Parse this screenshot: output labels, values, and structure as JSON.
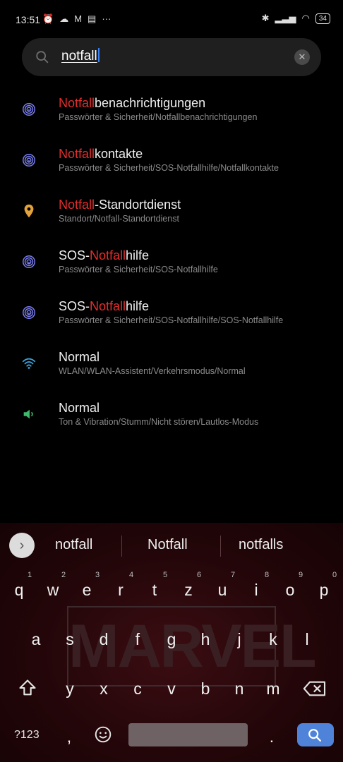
{
  "status": {
    "time": "13:51",
    "battery": "34"
  },
  "search": {
    "query": "notfall"
  },
  "results": [
    {
      "icon": "fingerprint-icon",
      "title_highlight": "Notfall",
      "title_pre": "",
      "title_post": "benachrichtigungen",
      "subtitle": "Passwörter & Sicherheit/Notfallbenachrichtigungen"
    },
    {
      "icon": "fingerprint-icon",
      "title_highlight": "Notfall",
      "title_pre": "",
      "title_post": "kontakte",
      "subtitle": "Passwörter & Sicherheit/SOS-Notfallhilfe/Notfallkontakte"
    },
    {
      "icon": "location-pin-icon",
      "title_highlight": "Notfall",
      "title_pre": "",
      "title_post": "-Standortdienst",
      "subtitle": "Standort/Notfall-Standortdienst"
    },
    {
      "icon": "fingerprint-icon",
      "title_highlight": "Notfall",
      "title_pre": "SOS-",
      "title_post": "hilfe",
      "subtitle": "Passwörter & Sicherheit/SOS-Notfallhilfe"
    },
    {
      "icon": "fingerprint-icon",
      "title_highlight": "Notfall",
      "title_pre": "SOS-",
      "title_post": "hilfe",
      "subtitle": "Passwörter & Sicherheit/SOS-Notfallhilfe/SOS-Notfallhilfe"
    },
    {
      "icon": "wifi-icon",
      "title_highlight": "",
      "title_pre": "Normal",
      "title_post": "",
      "subtitle": "WLAN/WLAN-Assistent/Verkehrsmodus/Normal"
    },
    {
      "icon": "speaker-icon",
      "title_highlight": "",
      "title_pre": "Normal",
      "title_post": "",
      "subtitle": "Ton & Vibration/Stumm/Nicht stören/Lautlos-Modus"
    }
  ],
  "keyboard": {
    "suggestions": [
      "notfall",
      "Notfall",
      "notfalls"
    ],
    "row1": [
      "q",
      "w",
      "e",
      "r",
      "t",
      "z",
      "u",
      "i",
      "o",
      "p"
    ],
    "row1_hints": [
      "1",
      "2",
      "3",
      "4",
      "5",
      "6",
      "7",
      "8",
      "9",
      "0"
    ],
    "row2": [
      "a",
      "s",
      "d",
      "f",
      "g",
      "h",
      "j",
      "k",
      "l"
    ],
    "row3": [
      "y",
      "x",
      "c",
      "v",
      "b",
      "n",
      "m"
    ],
    "symbols_key": "?123",
    "comma": ",",
    "period": ".",
    "background_logo": "MARVEL"
  },
  "colors": {
    "highlight": "#e52d2d",
    "fingerprint": "#7b7ff0",
    "location": "#e3a33a",
    "wifi": "#3aa0d8",
    "speaker": "#3dbb6b",
    "enter": "#4f83d9"
  }
}
